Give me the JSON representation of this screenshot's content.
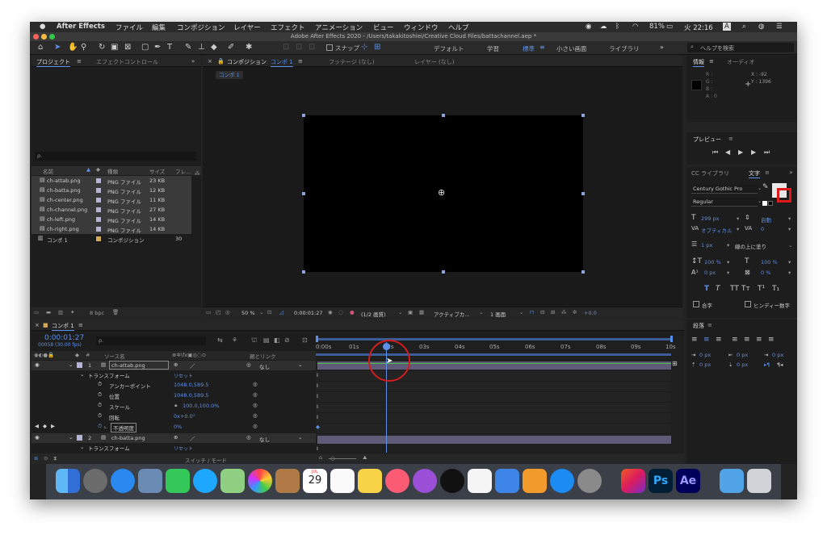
{
  "menubar": {
    "app": "After Effects",
    "items": [
      "ファイル",
      "編集",
      "コンポジション",
      "レイヤー",
      "エフェクト",
      "アニメーション",
      "ビュー",
      "ウィンドウ",
      "ヘルプ"
    ],
    "battery": "81%",
    "clock": "火 22:16",
    "input": "A"
  },
  "title": "Adobe After Effects 2020 - /Users/takakitoshiei/Creative Cloud Files/battachannel.aep *",
  "toolbar": {
    "snap": "スナップ",
    "workspaces": [
      "デフォルト",
      "学習",
      "標準",
      "小さい画面",
      "ライブラリ"
    ],
    "search_placeholder": "ヘルプを検索"
  },
  "project": {
    "tab": "プロジェクト",
    "tab2": "エフェクトコントロール",
    "search": "ρ.",
    "columns": [
      "名前",
      "種類",
      "サイズ",
      "フレ..."
    ],
    "items": [
      {
        "name": "ch-attab.png",
        "type": "PNG ファイル",
        "size": "23 KB",
        "color": "#b4b4d8"
      },
      {
        "name": "ch-batta.png",
        "type": "PNG ファイル",
        "size": "12 KB",
        "color": "#b4b4d8"
      },
      {
        "name": "ch-center.png",
        "type": "PNG ファイル",
        "size": "11 KB",
        "color": "#b4b4d8"
      },
      {
        "name": "ch-channel.png",
        "type": "PNG ファイル",
        "size": "27 KB",
        "color": "#b4b4d8"
      },
      {
        "name": "ch-left.png",
        "type": "PNG ファイル",
        "size": "14 KB",
        "color": "#b4b4d8"
      },
      {
        "name": "ch-right.png",
        "type": "PNG ファイル",
        "size": "14 KB",
        "color": "#b4b4d8"
      },
      {
        "name": "コンポ 1",
        "type": "コンポジション",
        "size": "30",
        "color": "#d2a95a"
      }
    ],
    "bpc": "8 bpc"
  },
  "comp": {
    "tab": "コンポジション",
    "tab_comp": "コンポ 1",
    "footage": "フッテージ (なし)",
    "layer": "レイヤー (なし)",
    "crumb": "コンポ 1",
    "zoom": "50 %",
    "time": "0:00:01:27",
    "res": "(1/2 画質)",
    "camera": "アクティブカ...",
    "views": "1 画面",
    "exposure": "+0.0"
  },
  "info": {
    "tab": "情報",
    "tab2": "オーディオ",
    "r": "R :",
    "g": "G :",
    "b": "B :",
    "a": "A : 0",
    "x": "X : -92",
    "y": "Y : 1396"
  },
  "preview": {
    "tab": "プレビュー"
  },
  "text": {
    "tab_lib": "CC ライブラリ",
    "tab": "文字",
    "font": "Century Gothic Pro",
    "style": "Regular",
    "size": "299 px",
    "leading": "自動",
    "kern": "オプティカル",
    "track": "0",
    "stroke": "1 px",
    "stroke_mode": "線の上に塗り",
    "vscale": "100 %",
    "hscale": "100 %",
    "baseline": "0 px",
    "tsume": "0 %",
    "ligature": "合字",
    "hindi": "ヒンディー数字"
  },
  "paragraph": {
    "tab": "段落",
    "v1": "0 px",
    "v2": "0 px",
    "v3": "0 px",
    "v4": "0 px",
    "v5": "0 px"
  },
  "timeline": {
    "tab": "コンポ 1",
    "time": "0:00:01:27",
    "frames": "00058 (30.00 fps)",
    "search": "ρ.",
    "col_source": "ソース名",
    "col_parent": "親とリンク",
    "footer": "スイッチ / モード",
    "ticks": [
      "0:00s",
      "01s",
      "02s",
      "03s",
      "04s",
      "05s",
      "06s",
      "07s",
      "08s",
      "09s",
      "10s"
    ],
    "layer1": {
      "num": "1",
      "name": "ch-attab.png",
      "parent": "なし"
    },
    "transform": "トランスフォーム",
    "reset": "リセット",
    "props": [
      {
        "name": "アンカーポイント",
        "value": "1048.0,589.5"
      },
      {
        "name": "位置",
        "value": "1048.0,589.5"
      },
      {
        "name": "スケール",
        "value": "100.0,100.0%"
      },
      {
        "name": "回転",
        "value": "0x+0.0°"
      },
      {
        "name": "不透明度",
        "value": "0%"
      }
    ],
    "layer2": {
      "num": "2",
      "name": "ch-batta.png",
      "parent": "なし"
    },
    "transform2": "トランスフォーム",
    "reset2": "リセット"
  },
  "dock": {
    "calendar_month": "JUL",
    "calendar_day": "29",
    "ps": "Ps",
    "ae": "Ae"
  }
}
